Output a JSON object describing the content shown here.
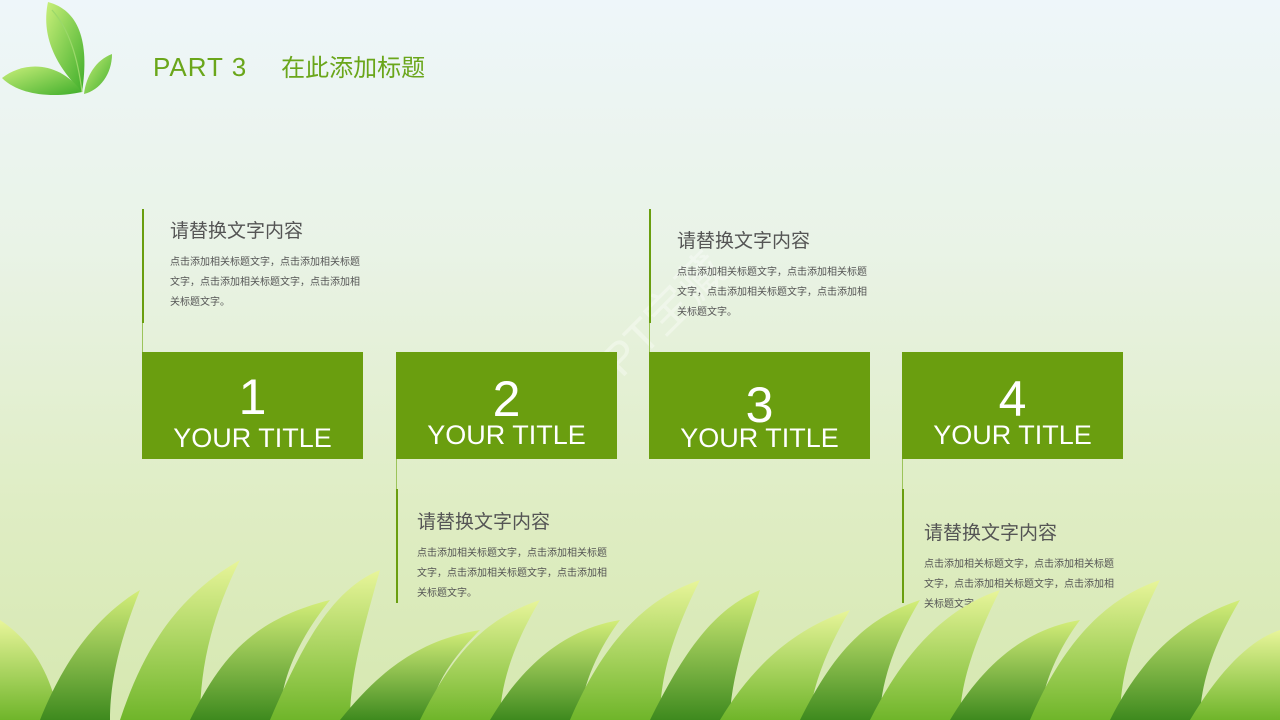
{
  "header": {
    "part": "PART 3",
    "title": "在此添加标题"
  },
  "steps": [
    {
      "number": "1",
      "title": "YOUR TITLE",
      "heading": "请替换文字内容",
      "lines": [
        "点击添加相关标题文字，点击添加相关标题",
        "文字，点击添加相关标题文字，点击添加相",
        "关标题文字。"
      ]
    },
    {
      "number": "2",
      "title": "YOUR TITLE",
      "heading": "请替换文字内容",
      "lines": [
        "点击添加相关标题文字，点击添加相关标题",
        "文字，点击添加相关标题文字，点击添加相",
        "关标题文字。"
      ]
    },
    {
      "number": "3",
      "title": "YOUR TITLE",
      "heading": "请替换文字内容",
      "lines": [
        "点击添加相关标题文字，点击添加相关标题",
        "文字，点击添加相关标题文字，点击添加相",
        "关标题文字。"
      ]
    },
    {
      "number": "4",
      "title": "YOUR TITLE",
      "heading": "请替换文字内容",
      "lines": [
        "点击添加相关标题文字，点击添加相关标题",
        "文字，点击添加相关标题文字，点击添加相",
        "关标题文字。"
      ]
    }
  ],
  "watermark": "PPT宝藏",
  "colors": {
    "accent": "#6a9e0f",
    "header_text": "#6aa61a",
    "body_text": "#555555"
  }
}
